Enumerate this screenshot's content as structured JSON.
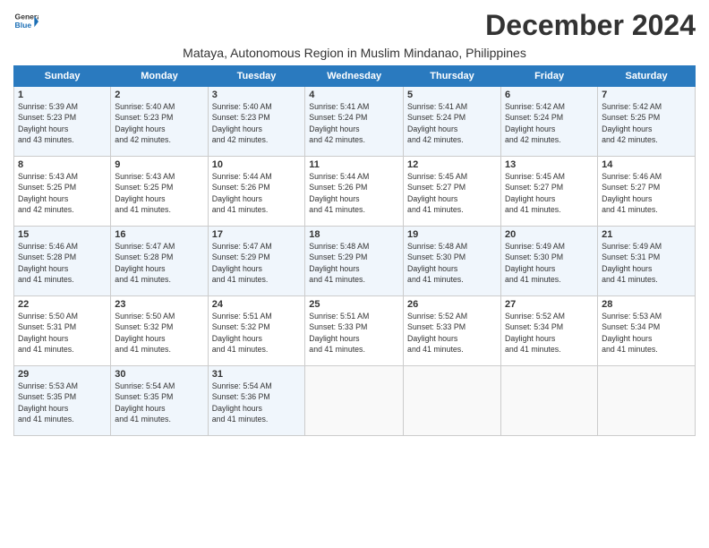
{
  "logo": {
    "line1": "General",
    "line2": "Blue"
  },
  "title": "December 2024",
  "location": "Mataya, Autonomous Region in Muslim Mindanao, Philippines",
  "days_of_week": [
    "Sunday",
    "Monday",
    "Tuesday",
    "Wednesday",
    "Thursday",
    "Friday",
    "Saturday"
  ],
  "weeks": [
    [
      {
        "day": "1",
        "sunrise": "5:39 AM",
        "sunset": "5:23 PM",
        "daylight": "11 hours and 43 minutes."
      },
      {
        "day": "2",
        "sunrise": "5:40 AM",
        "sunset": "5:23 PM",
        "daylight": "11 hours and 42 minutes."
      },
      {
        "day": "3",
        "sunrise": "5:40 AM",
        "sunset": "5:23 PM",
        "daylight": "11 hours and 42 minutes."
      },
      {
        "day": "4",
        "sunrise": "5:41 AM",
        "sunset": "5:24 PM",
        "daylight": "11 hours and 42 minutes."
      },
      {
        "day": "5",
        "sunrise": "5:41 AM",
        "sunset": "5:24 PM",
        "daylight": "11 hours and 42 minutes."
      },
      {
        "day": "6",
        "sunrise": "5:42 AM",
        "sunset": "5:24 PM",
        "daylight": "11 hours and 42 minutes."
      },
      {
        "day": "7",
        "sunrise": "5:42 AM",
        "sunset": "5:25 PM",
        "daylight": "11 hours and 42 minutes."
      }
    ],
    [
      {
        "day": "8",
        "sunrise": "5:43 AM",
        "sunset": "5:25 PM",
        "daylight": "11 hours and 42 minutes."
      },
      {
        "day": "9",
        "sunrise": "5:43 AM",
        "sunset": "5:25 PM",
        "daylight": "11 hours and 41 minutes."
      },
      {
        "day": "10",
        "sunrise": "5:44 AM",
        "sunset": "5:26 PM",
        "daylight": "11 hours and 41 minutes."
      },
      {
        "day": "11",
        "sunrise": "5:44 AM",
        "sunset": "5:26 PM",
        "daylight": "11 hours and 41 minutes."
      },
      {
        "day": "12",
        "sunrise": "5:45 AM",
        "sunset": "5:27 PM",
        "daylight": "11 hours and 41 minutes."
      },
      {
        "day": "13",
        "sunrise": "5:45 AM",
        "sunset": "5:27 PM",
        "daylight": "11 hours and 41 minutes."
      },
      {
        "day": "14",
        "sunrise": "5:46 AM",
        "sunset": "5:27 PM",
        "daylight": "11 hours and 41 minutes."
      }
    ],
    [
      {
        "day": "15",
        "sunrise": "5:46 AM",
        "sunset": "5:28 PM",
        "daylight": "11 hours and 41 minutes."
      },
      {
        "day": "16",
        "sunrise": "5:47 AM",
        "sunset": "5:28 PM",
        "daylight": "11 hours and 41 minutes."
      },
      {
        "day": "17",
        "sunrise": "5:47 AM",
        "sunset": "5:29 PM",
        "daylight": "11 hours and 41 minutes."
      },
      {
        "day": "18",
        "sunrise": "5:48 AM",
        "sunset": "5:29 PM",
        "daylight": "11 hours and 41 minutes."
      },
      {
        "day": "19",
        "sunrise": "5:48 AM",
        "sunset": "5:30 PM",
        "daylight": "11 hours and 41 minutes."
      },
      {
        "day": "20",
        "sunrise": "5:49 AM",
        "sunset": "5:30 PM",
        "daylight": "11 hours and 41 minutes."
      },
      {
        "day": "21",
        "sunrise": "5:49 AM",
        "sunset": "5:31 PM",
        "daylight": "11 hours and 41 minutes."
      }
    ],
    [
      {
        "day": "22",
        "sunrise": "5:50 AM",
        "sunset": "5:31 PM",
        "daylight": "11 hours and 41 minutes."
      },
      {
        "day": "23",
        "sunrise": "5:50 AM",
        "sunset": "5:32 PM",
        "daylight": "11 hours and 41 minutes."
      },
      {
        "day": "24",
        "sunrise": "5:51 AM",
        "sunset": "5:32 PM",
        "daylight": "11 hours and 41 minutes."
      },
      {
        "day": "25",
        "sunrise": "5:51 AM",
        "sunset": "5:33 PM",
        "daylight": "11 hours and 41 minutes."
      },
      {
        "day": "26",
        "sunrise": "5:52 AM",
        "sunset": "5:33 PM",
        "daylight": "11 hours and 41 minutes."
      },
      {
        "day": "27",
        "sunrise": "5:52 AM",
        "sunset": "5:34 PM",
        "daylight": "11 hours and 41 minutes."
      },
      {
        "day": "28",
        "sunrise": "5:53 AM",
        "sunset": "5:34 PM",
        "daylight": "11 hours and 41 minutes."
      }
    ],
    [
      {
        "day": "29",
        "sunrise": "5:53 AM",
        "sunset": "5:35 PM",
        "daylight": "11 hours and 41 minutes."
      },
      {
        "day": "30",
        "sunrise": "5:54 AM",
        "sunset": "5:35 PM",
        "daylight": "11 hours and 41 minutes."
      },
      {
        "day": "31",
        "sunrise": "5:54 AM",
        "sunset": "5:36 PM",
        "daylight": "11 hours and 41 minutes."
      },
      null,
      null,
      null,
      null
    ]
  ]
}
